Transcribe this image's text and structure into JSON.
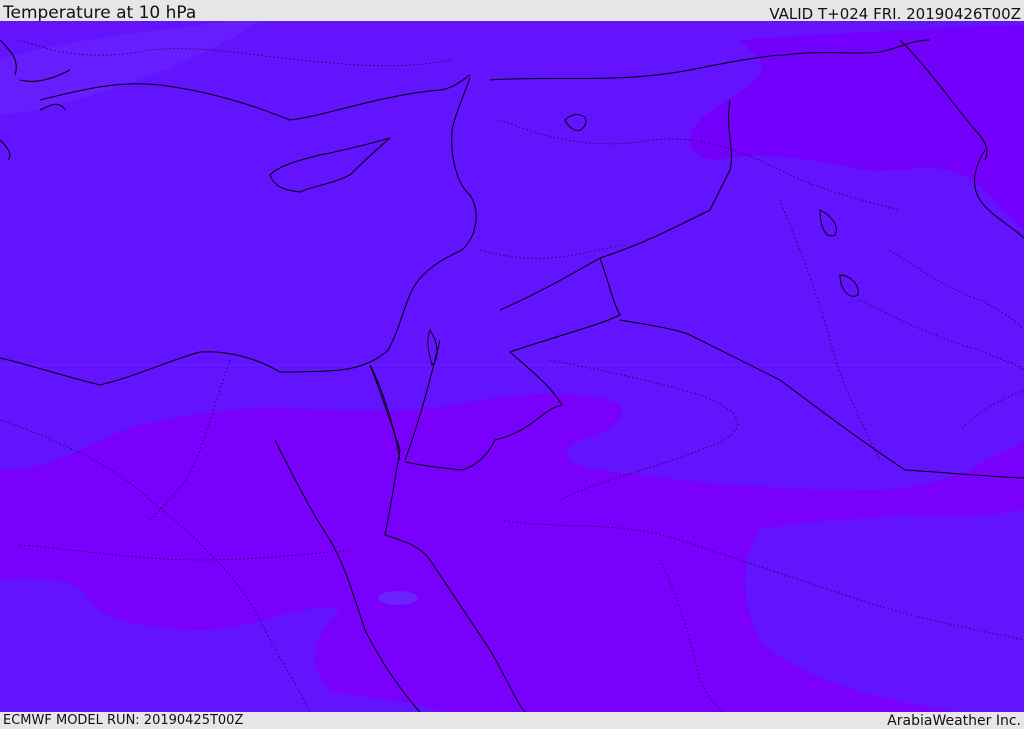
{
  "header": {
    "title": "Temperature at 10 hPa",
    "valid": "VALID T+024 FRI. 20190426T00Z"
  },
  "footer": {
    "model_run": "ECMWF MODEL RUN: 20190425T00Z",
    "credit": "ArabiaWeather Inc."
  },
  "map": {
    "colors": {
      "cold_band": "#6313fe",
      "cool_band": "#6a17fe",
      "warm_band": "#7b00fd",
      "land_border": "#000000"
    }
  }
}
